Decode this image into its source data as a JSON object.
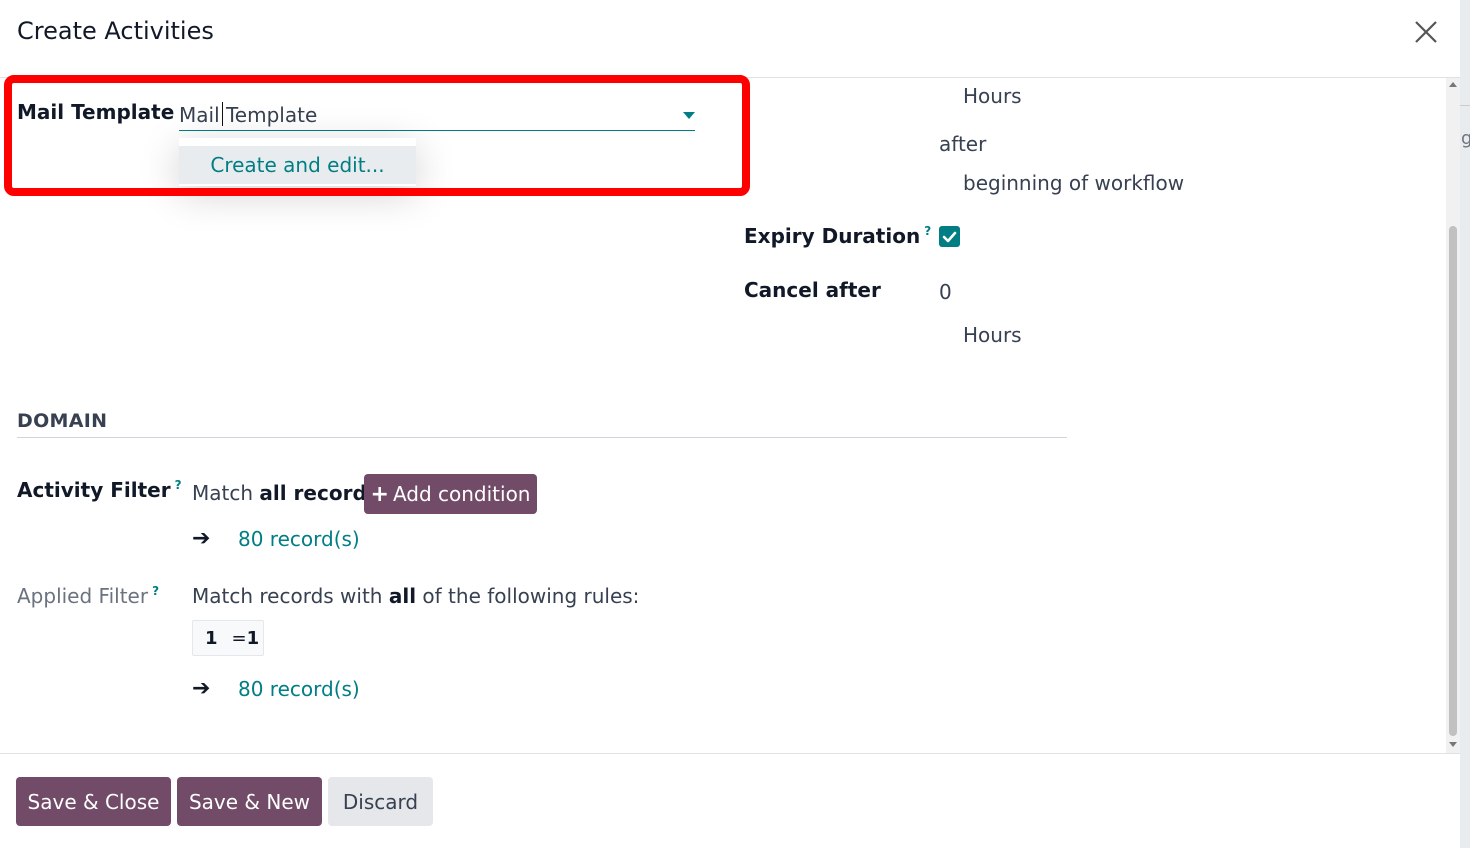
{
  "dialog": {
    "title": "Create Activities",
    "close_icon": "close-icon"
  },
  "mail_template": {
    "label": "Mail Template",
    "value": "Mail Template",
    "dropdown_item": "Create and edit..."
  },
  "deadline": {
    "unit": "Hours",
    "after": "after",
    "reference": "beginning of workflow"
  },
  "expiry": {
    "label": "Expiry Duration",
    "help": "?",
    "checked": true
  },
  "cancel_after": {
    "label": "Cancel after",
    "value": "0",
    "unit": "Hours"
  },
  "domain": {
    "section_title": "DOMAIN",
    "activity_filter": {
      "label": "Activity Filter",
      "help": "?",
      "match_prefix": "Match",
      "match_bold": "all records",
      "add_condition": "Add condition",
      "records_link": "80 record(s)"
    },
    "applied_filter": {
      "label": "Applied Filter",
      "help": "?",
      "rule_text_prefix": "Match records with",
      "rule_text_bold": "all",
      "rule_text_suffix": "of the following rules:",
      "rule_left": "1",
      "rule_op": "=",
      "rule_right": "1",
      "records_link": "80 record(s)"
    }
  },
  "footer": {
    "save_close": "Save & Close",
    "save_new": "Save & New",
    "discard": "Discard"
  },
  "colors": {
    "primary": "#714b67",
    "accent": "#017e84",
    "highlight": "#ff0000"
  }
}
